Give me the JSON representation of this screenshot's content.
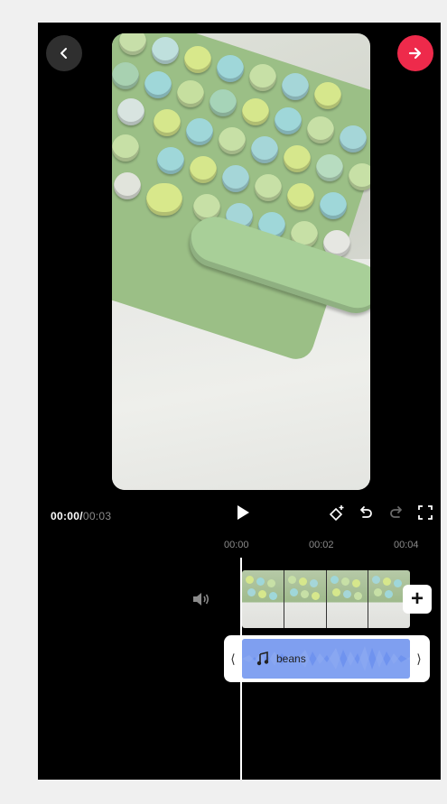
{
  "nav": {
    "back_icon": "chevron-left-icon",
    "next_icon": "arrow-right-icon",
    "next_color": "#ee2a4b"
  },
  "player": {
    "current_time": "00:00",
    "separator": "/",
    "total_time": "00:03",
    "play_icon": "play-icon",
    "tools": [
      "keyframe-icon",
      "undo-icon",
      "redo-icon",
      "fullscreen-icon"
    ]
  },
  "timeline": {
    "ruler": [
      "00:00",
      "00:02",
      "00:04"
    ],
    "audio_clip": {
      "title": "beans",
      "color": "#6f93ef"
    },
    "add_clip_label": "+"
  }
}
